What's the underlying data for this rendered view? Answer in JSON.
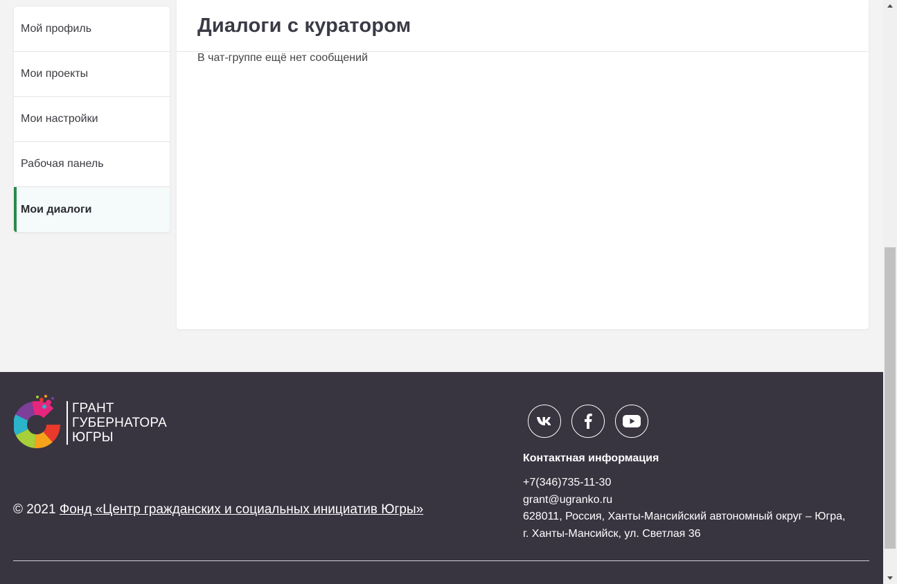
{
  "sidebar": {
    "items": [
      {
        "label": "Мой профиль"
      },
      {
        "label": "Мои проекты"
      },
      {
        "label": "Мои настройки"
      },
      {
        "label": "Рабочая панель"
      },
      {
        "label": "Мои диалоги",
        "active": true
      }
    ]
  },
  "main": {
    "title": "Диалоги с куратором",
    "empty_message": "В чат-группе ещё нет сообщений"
  },
  "footer": {
    "logo": {
      "line1": "ГРАНТ",
      "line2": "ГУБЕРНАТОРА",
      "line3": "ЮГРЫ"
    },
    "copyright_prefix": "© 2021",
    "copyright_link": "Фонд «Центр гражданских и социальных инициатив Югры»",
    "socials": [
      {
        "icon": "vk-icon"
      },
      {
        "icon": "facebook-icon"
      },
      {
        "icon": "youtube-icon"
      }
    ],
    "contacts_title": "Контактная информация",
    "phone": "+7(346)735-11-30",
    "email": "grant@ugranko.ru",
    "address_line1": "628011, Россия, Ханты-Мансийский автономный округ – Югра,",
    "address_line2": "г. Ханты-Мансийск, ул. Светлая 36"
  },
  "colors": {
    "accent": "#2a8a4a",
    "footer_bg": "#383440",
    "page_bg": "#f3f3f3"
  }
}
